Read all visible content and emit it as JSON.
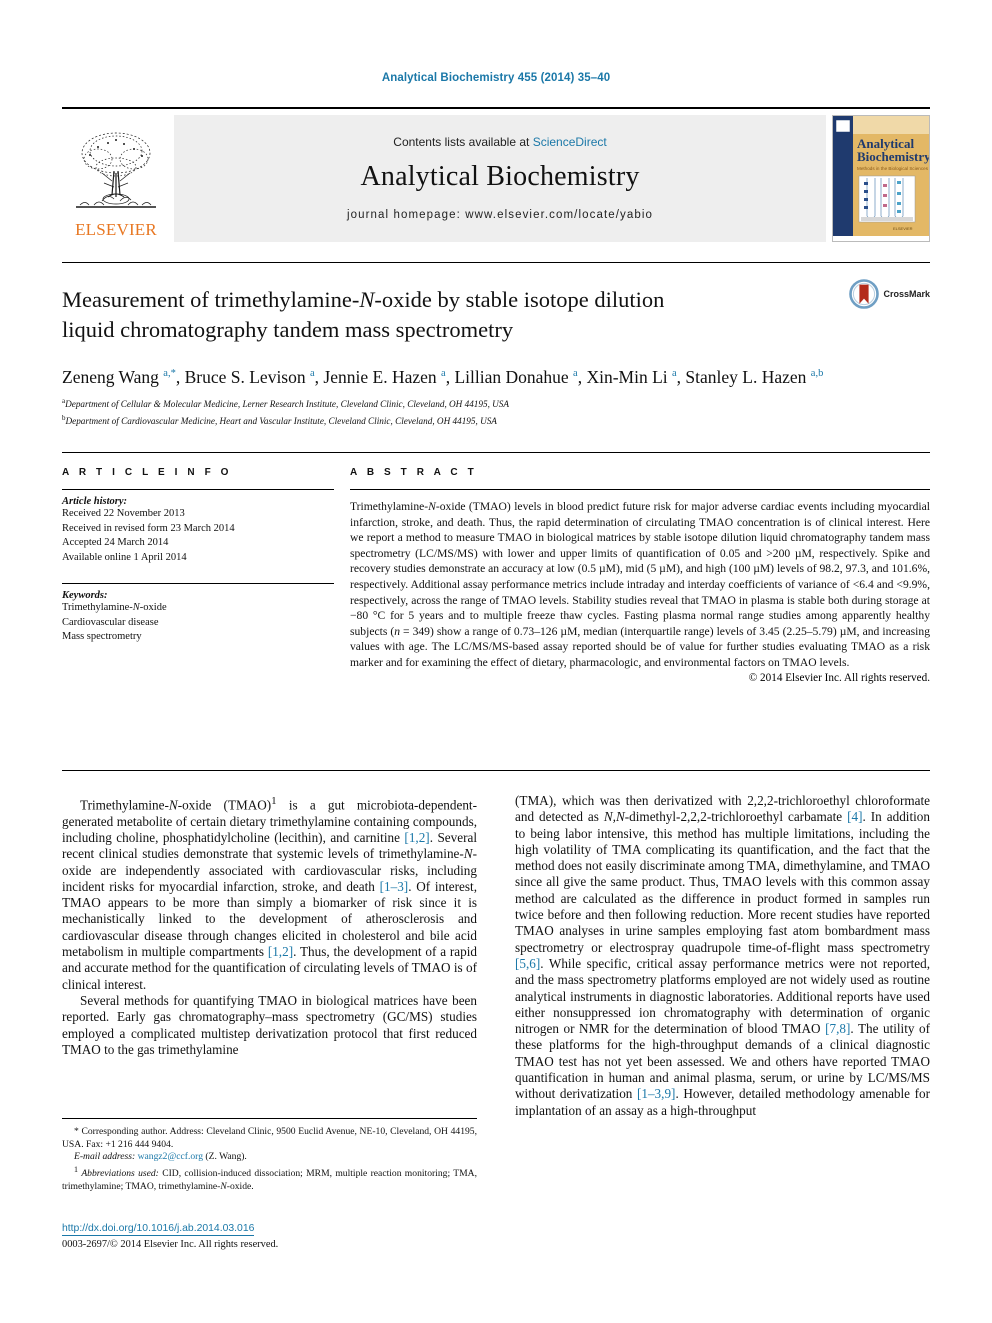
{
  "running_head": "Analytical Biochemistry 455 (2014) 35–40",
  "masthead": {
    "publisher_name": "ELSEVIER",
    "contents_prefix": "Contents lists available at ",
    "sciencedirect": "ScienceDirect",
    "journal_name": "Analytical Biochemistry",
    "homepage": "journal homepage: www.elsevier.com/locate/yabio",
    "cover": {
      "title_line1": "Analytical",
      "title_line2": "Biochemistry",
      "subtitle": "Methods in the Biological Sciences",
      "publisher_mark": "ELSEVIER"
    }
  },
  "article": {
    "title_line1_pre": "Measurement of trimethylamine-",
    "title_italic": "N",
    "title_line1_post": "-oxide by stable isotope dilution",
    "title_line2": "liquid chromatography tandem mass spectrometry",
    "crossmark_label": "CrossMark",
    "authors_html": "Zeneng Wang <sup>a,*</sup>, Bruce S. Levison <sup>a</sup>, Jennie E. Hazen <sup>a</sup>, Lillian Donahue <sup>a</sup>, Xin-Min Li <sup>a</sup>, Stanley L. Hazen <sup>a,b</sup>",
    "affiliations": [
      "Department of Cellular & Molecular Medicine, Lerner Research Institute, Cleveland Clinic, Cleveland, OH 44195, USA",
      "Department of Cardiovascular Medicine, Heart and Vascular Institute, Cleveland Clinic, Cleveland, OH 44195, USA"
    ],
    "affiliation_markers": [
      "a",
      "b"
    ]
  },
  "article_info": {
    "heading": "A R T I C L E   I N F O",
    "history_label": "Article history:",
    "history": [
      "Received 22 November 2013",
      "Received in revised form 23 March 2014",
      "Accepted 24 March 2014",
      "Available online 1 April 2014"
    ],
    "keywords_label": "Keywords:",
    "keywords": [
      "Trimethylamine-N-oxide",
      "Cardiovascular disease",
      "Mass spectrometry"
    ]
  },
  "abstract": {
    "heading": "A B S T R A C T",
    "text": "Trimethylamine-N-oxide (TMAO) levels in blood predict future risk for major adverse cardiac events including myocardial infarction, stroke, and death. Thus, the rapid determination of circulating TMAO concentration is of clinical interest. Here we report a method to measure TMAO in biological matrices by stable isotope dilution liquid chromatography tandem mass spectrometry (LC/MS/MS) with lower and upper limits of quantification of 0.05 and >200 µM, respectively. Spike and recovery studies demonstrate an accuracy at low (0.5 µM), mid (5 µM), and high (100 µM) levels of 98.2, 97.3, and 101.6%, respectively. Additional assay performance metrics include intraday and interday coefficients of variance of <6.4 and <9.9%, respectively, across the range of TMAO levels. Stability studies reveal that TMAO in plasma is stable both during storage at −80 °C for 5 years and to multiple freeze thaw cycles. Fasting plasma normal range studies among apparently healthy subjects (n = 349) show a range of 0.73–126 µM, median (interquartile range) levels of 3.45 (2.25–5.79) µM, and increasing values with age. The LC/MS/MS-based assay reported should be of value for further studies evaluating TMAO as a risk marker and for examining the effect of dietary, pharmacologic, and environmental factors on TMAO levels.",
    "copyright": "© 2014 Elsevier Inc. All rights reserved."
  },
  "body": {
    "left_paragraphs": [
      "Trimethylamine-N-oxide (TMAO)1 is a gut microbiota-dependent-generated metabolite of certain dietary trimethylamine containing compounds, including choline, phosphatidylcholine (lecithin), and carnitine [1,2]. Several recent clinical studies demonstrate that systemic levels of trimethylamine-N-oxide are independently associated with cardiovascular risks, including incident risks for myocardial infarction, stroke, and death [1–3]. Of interest, TMAO appears to be more than simply a biomarker of risk since it is mechanistically linked to the development of atherosclerosis and cardiovascular disease through changes elicited in cholesterol and bile acid metabolism in multiple compartments [1,2]. Thus, the development of a rapid and accurate method for the quantification of circulating levels of TMAO is of clinical interest.",
      "Several methods for quantifying TMAO in biological matrices have been reported. Early gas chromatography–mass spectrometry (GC/MS) studies employed a complicated multistep derivatization protocol that first reduced TMAO to the gas trimethylamine"
    ],
    "right_paragraphs": [
      "(TMA), which was then derivatized with 2,2,2-trichloroethyl chloroformate and detected as N,N-dimethyl-2,2,2-trichloroethyl carbamate [4]. In addition to being labor intensive, this method has multiple limitations, including the high volatility of TMA complicating its quantification, and the fact that the method does not easily discriminate among TMA, dimethylamine, and TMAO since all give the same product. Thus, TMAO levels with this common assay method are calculated as the difference in product formed in samples run twice before and then following reduction. More recent studies have reported TMAO analyses in urine samples employing fast atom bombardment mass spectrometry or electrospray quadrupole time-of-flight mass spectrometry [5,6]. While specific, critical assay performance metrics were not reported, and the mass spectrometry platforms employed are not widely used as routine analytical instruments in diagnostic laboratories. Additional reports have used either nonsuppressed ion chromatography with determination of organic nitrogen or NMR for the determination of blood TMAO [7,8]. The utility of these platforms for the high-throughput demands of a clinical diagnostic TMAO test has not yet been assessed. We and others have reported TMAO quantification in human and animal plasma, serum, or urine by LC/MS/MS without derivatization [1–3,9]. However, detailed methodology amenable for implantation of an assay as a high-throughput"
    ]
  },
  "footnotes": {
    "corresponding": "* Corresponding author. Address: Cleveland Clinic, 9500 Euclid Avenue, NE-10, Cleveland, OH 44195, USA. Fax: +1 216 444 9404.",
    "email_label": "E-mail address:",
    "email": "wangz2@ccf.org",
    "email_suffix": "(Z. Wang).",
    "abbrev_marker": "1",
    "abbrev_label": "Abbreviations used:",
    "abbrev_text": "CID, collision-induced dissociation; MRM, multiple reaction monitoring; TMA, trimethylamine; TMAO, trimethylamine-N-oxide."
  },
  "doi": {
    "url": "http://dx.doi.org/10.1016/j.ab.2014.03.016",
    "issn_line": "0003-2697/© 2014 Elsevier Inc. All rights reserved."
  },
  "colors": {
    "link": "#1b78a8",
    "elsevier_orange": "#e87722",
    "band_gray": "#eeeeee",
    "cover_navy": "#1f3a6e",
    "cover_gold": "#d9a441"
  }
}
